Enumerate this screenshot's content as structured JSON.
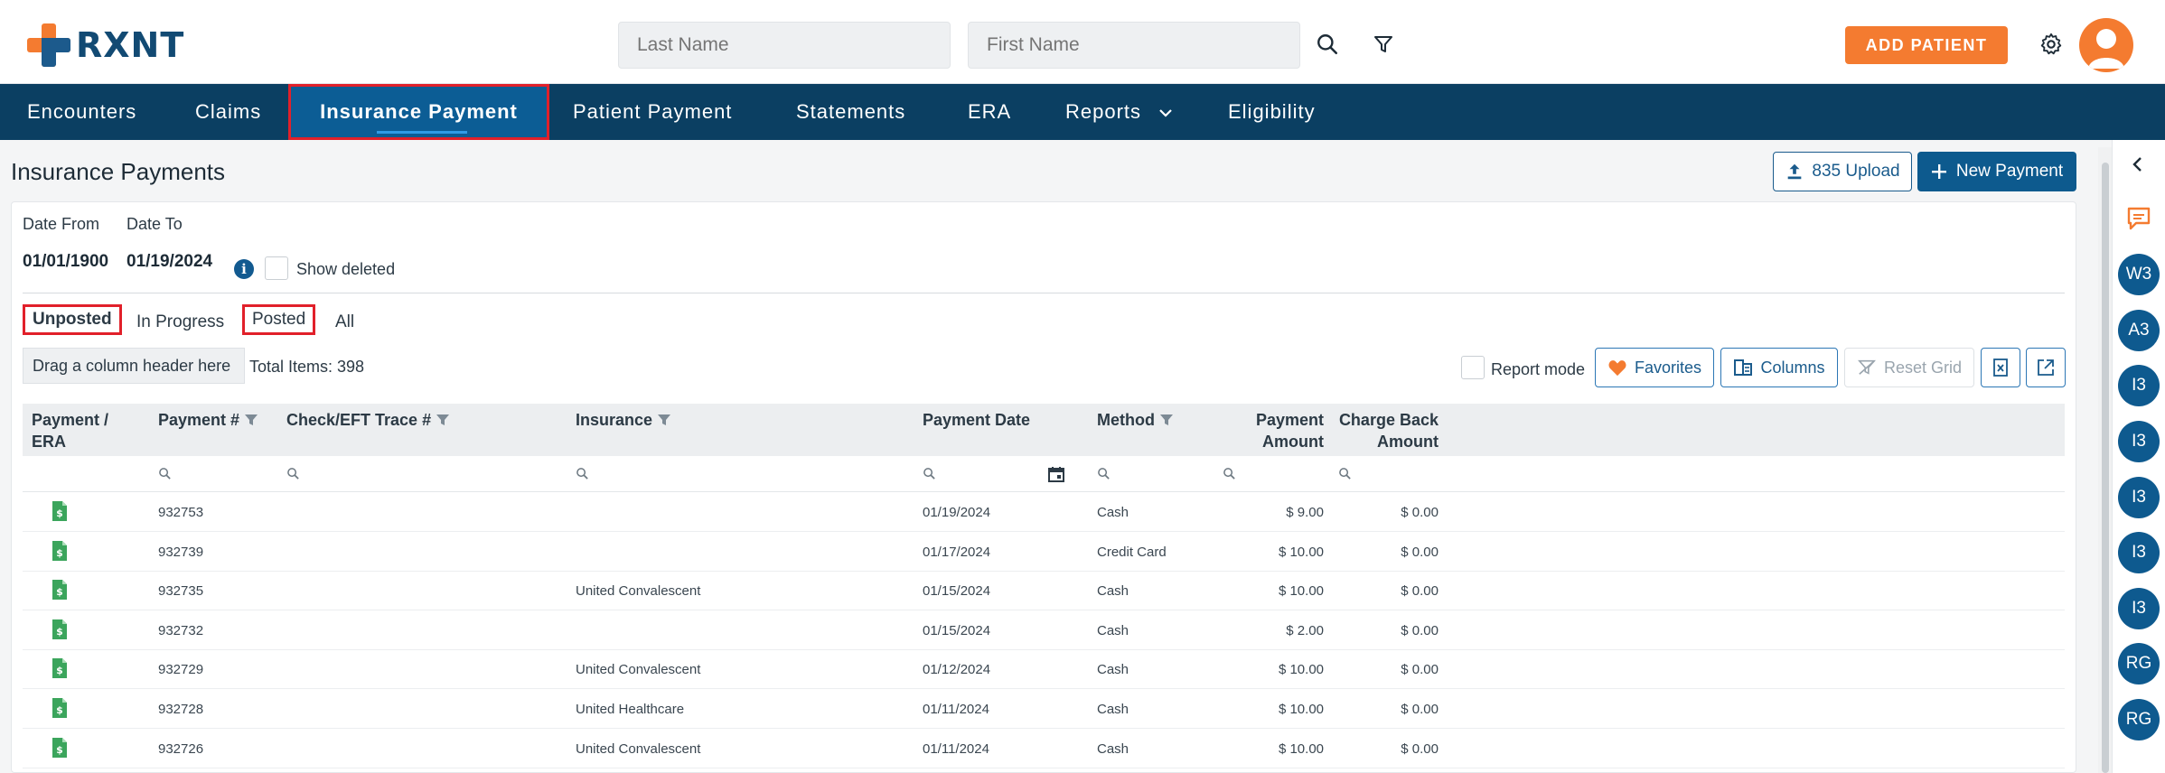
{
  "header": {
    "logo_text": "RXNT",
    "last_name_placeholder": "Last Name",
    "first_name_placeholder": "First Name",
    "add_patient_label": "ADD PATIENT"
  },
  "nav": {
    "items": [
      {
        "label": "Encounters"
      },
      {
        "label": "Claims"
      },
      {
        "label": "Insurance Payment",
        "active": true
      },
      {
        "label": "Patient Payment"
      },
      {
        "label": "Statements"
      },
      {
        "label": "ERA"
      },
      {
        "label": "Reports"
      },
      {
        "label": "Eligibility"
      }
    ]
  },
  "page": {
    "title": "Insurance Payments",
    "upload_label": "835 Upload",
    "new_payment_label": "New Payment"
  },
  "filters": {
    "date_from_label": "Date From",
    "date_to_label": "Date To",
    "date_from": "01/01/1900",
    "date_to": "01/19/2024",
    "show_deleted_label": "Show deleted"
  },
  "tabs": [
    {
      "label": "Unposted",
      "highlighted": true,
      "active": true
    },
    {
      "label": "In Progress"
    },
    {
      "label": "Posted",
      "highlighted": true
    },
    {
      "label": "All"
    }
  ],
  "toolbar": {
    "drag_hint": "Drag a column header here",
    "total_items": "Total Items: 398",
    "report_mode_label": "Report mode",
    "favorites_label": "Favorites",
    "columns_label": "Columns",
    "reset_grid_label": "Reset Grid"
  },
  "grid": {
    "columns": {
      "payment_era": "Payment / ERA",
      "payment_no": "Payment #",
      "check_eft": "Check/EFT Trace #",
      "insurance": "Insurance",
      "payment_date": "Payment Date",
      "method": "Method",
      "payment_amount": "Payment Amount",
      "charge_back": "Charge Back Amount"
    },
    "rows": [
      {
        "payment_no": "932753",
        "check_eft": "",
        "insurance": "",
        "payment_date": "01/19/2024",
        "method": "Cash",
        "payment_amount": "$ 9.00",
        "charge_back": "$ 0.00"
      },
      {
        "payment_no": "932739",
        "check_eft": "",
        "insurance": "",
        "payment_date": "01/17/2024",
        "method": "Credit Card",
        "payment_amount": "$ 10.00",
        "charge_back": "$ 0.00"
      },
      {
        "payment_no": "932735",
        "check_eft": "",
        "insurance": "United Convalescent",
        "payment_date": "01/15/2024",
        "method": "Cash",
        "payment_amount": "$ 10.00",
        "charge_back": "$ 0.00"
      },
      {
        "payment_no": "932732",
        "check_eft": "",
        "insurance": "",
        "payment_date": "01/15/2024",
        "method": "Cash",
        "payment_amount": "$ 2.00",
        "charge_back": "$ 0.00"
      },
      {
        "payment_no": "932729",
        "check_eft": "",
        "insurance": "United Convalescent",
        "payment_date": "01/12/2024",
        "method": "Cash",
        "payment_amount": "$ 10.00",
        "charge_back": "$ 0.00"
      },
      {
        "payment_no": "932728",
        "check_eft": "",
        "insurance": "United Healthcare",
        "payment_date": "01/11/2024",
        "method": "Cash",
        "payment_amount": "$ 10.00",
        "charge_back": "$ 0.00"
      },
      {
        "payment_no": "932726",
        "check_eft": "",
        "insurance": "United Convalescent",
        "payment_date": "01/11/2024",
        "method": "Cash",
        "payment_amount": "$ 10.00",
        "charge_back": "$ 0.00"
      }
    ]
  },
  "rail": {
    "bubbles": [
      "W3",
      "A3",
      "I3",
      "I3",
      "I3",
      "I3",
      "I3",
      "RG",
      "RG"
    ]
  },
  "colors": {
    "brand_orange": "#f47b30",
    "nav_bg": "#0b3f62",
    "active_tab_bg": "#0c5d95",
    "highlight_red": "#e1202a",
    "primary_blue": "#0d5a8e",
    "pay_icon_green": "#3ba55c"
  }
}
